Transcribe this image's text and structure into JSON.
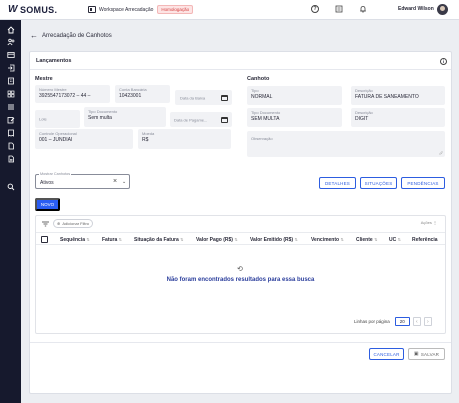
{
  "topbar": {
    "logo_mark": "W",
    "logo_text": "SOMUS.",
    "workspace": "Workspace Arrecadação",
    "env_badge": "Homologação",
    "user_name": "Edward Wilson"
  },
  "page": {
    "title": "Arrecadação de Canhotos"
  },
  "card": {
    "title": "Lançamentos",
    "mestre": {
      "title": "Mestre",
      "numero_mestre": {
        "label": "Número Mestre",
        "value": "3925547173072 – 44 –"
      },
      "conta_bancaria": {
        "label": "Conta Bancária",
        "value": "10423001"
      },
      "data_baixa": {
        "label": "Data da Baixa"
      },
      "lote": {
        "label": "Lote"
      },
      "tipo_documento": {
        "label": "Tipo Documento",
        "value": "Sem multa"
      },
      "data_pagamento": {
        "label": "Data de Pagame..."
      },
      "controle_operacional": {
        "label": "Controle Operacional",
        "value": "001 – JUNDIAI"
      },
      "moeda": {
        "label": "Moeda",
        "value": "R$"
      }
    },
    "canhoto": {
      "title": "Canhoto",
      "tipo": {
        "label": "Tipo",
        "value": "NORMAL"
      },
      "descricao1": {
        "label": "Descrição",
        "value": "FATURA DE SANEAMENTO"
      },
      "tipo_documento": {
        "label": "Tipo Documento",
        "value": "SEM MULTA"
      },
      "descricao2": {
        "label": "Descrição",
        "value": "DIGIT"
      },
      "observacao": {
        "label": "Observação"
      }
    },
    "select": {
      "label": "Mostrar Canhotos",
      "value": "Ativos"
    },
    "buttons": {
      "detalhes": "DETALHES",
      "situacoes": "SITUAÇÕES",
      "pendencias": "PENDÊNCIAS",
      "novo": "NOVO",
      "cancelar": "CANCELAR",
      "salvar": "SALVAR"
    },
    "table": {
      "add_filter": "Adicionar Filtro",
      "acoes": "Ações",
      "columns": [
        "Sequência",
        "Fatura",
        "Situação da Fatura",
        "Valor Pago (R$)",
        "Valor Emitido (R$)",
        "Vencimento",
        "Cliente",
        "UC",
        "Referência"
      ],
      "empty_message": "Não foram encontrados resultados para essa busca",
      "rows_per_page_label": "Linhas por página",
      "rows_per_page": "20"
    }
  }
}
